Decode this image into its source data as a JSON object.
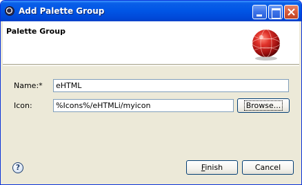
{
  "window": {
    "title": "Add Palette Group"
  },
  "banner": {
    "title": "Palette Group"
  },
  "form": {
    "name_label": "Name:*",
    "name_value": "eHTML",
    "icon_label": "Icon:",
    "icon_value": "%Icons%/eHTMLi/myicon"
  },
  "buttons": {
    "browse_label": "Browse...",
    "finish_mnemonic": "F",
    "finish_rest": "inish",
    "cancel_label": "Cancel"
  },
  "icons": {
    "window_icon": "eclipse-icon",
    "banner_image": "palette-sphere-icon",
    "help": "help-icon"
  },
  "colors": {
    "titlebar": "#0055e5",
    "dialog_bg": "#ece9d8",
    "banner_sphere": "#d42a2a"
  }
}
